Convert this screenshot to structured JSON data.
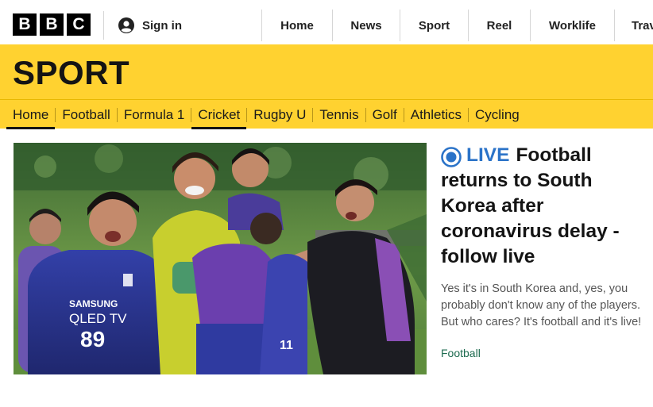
{
  "header": {
    "logo_letters": [
      "B",
      "B",
      "C"
    ],
    "signin_label": "Sign in",
    "nav": [
      "Home",
      "News",
      "Sport",
      "Reel",
      "Worklife",
      "Trav"
    ]
  },
  "sport": {
    "title": "SPORT",
    "nav": [
      {
        "label": "Home",
        "active": true
      },
      {
        "label": "Football",
        "active": false
      },
      {
        "label": "Formula 1",
        "active": false
      },
      {
        "label": "Cricket",
        "active": true
      },
      {
        "label": "Rugby U",
        "active": false
      },
      {
        "label": "Tennis",
        "active": false
      },
      {
        "label": "Golf",
        "active": false
      },
      {
        "label": "Athletics",
        "active": false
      },
      {
        "label": "Cycling",
        "active": false
      }
    ]
  },
  "hero": {
    "shirt_sponsor_line1": "SAMSUNG",
    "shirt_sponsor_line2": "QLED TV",
    "shirt_number": "89",
    "shirt_number_2": "11"
  },
  "story": {
    "live_label": "LIVE",
    "headline": "Football returns to South Korea after coronavirus delay - follow live",
    "summary": "Yes it's in South Korea and, yes, you probably don't know any of the players. But who cares? It's football and it's live!",
    "tag": "Football"
  },
  "colors": {
    "sport_yellow": "#ffd230",
    "live_blue": "#2b73c8",
    "tag_green": "#1d6b4f"
  }
}
